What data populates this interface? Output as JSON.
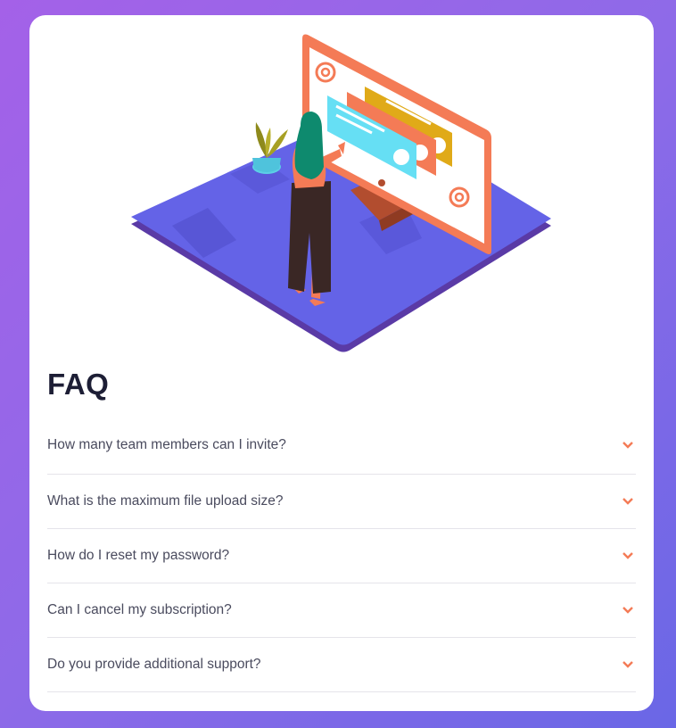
{
  "faq": {
    "title": "FAQ",
    "questions": [
      {
        "label": "How many team members can I invite?"
      },
      {
        "label": "What is the maximum file upload size?"
      },
      {
        "label": "How do I reset my password?"
      },
      {
        "label": "Can I cancel my subscription?"
      },
      {
        "label": "Do you provide additional support?"
      }
    ],
    "expand_icon": "chevron-down-icon"
  },
  "illustration": {
    "monitor_icons": [
      "at-sign-icon",
      "at-sign-icon"
    ]
  },
  "colors": {
    "background_start": "#a461e8",
    "background_end": "#6a67e6",
    "accent": "#f47b56",
    "heading": "#1d1e35",
    "text": "#4a4b5e",
    "divider": "#e5e4ea"
  }
}
